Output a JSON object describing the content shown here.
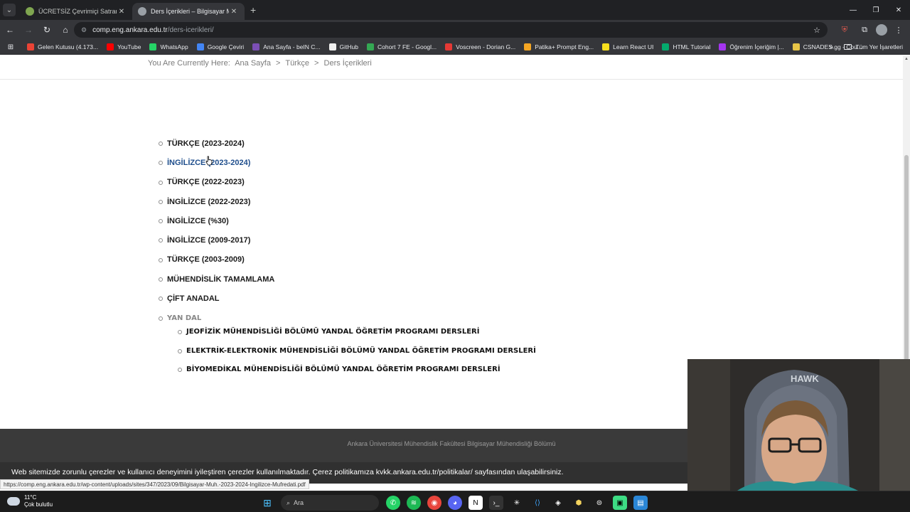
{
  "browser": {
    "tabs": [
      {
        "title": "ÜCRETSİZ Çevrimiçi Satranç Oy",
        "active": false,
        "favicon_color": "#7fa650"
      },
      {
        "title": "Ders İçerikleri – Bilgisayar Mühe",
        "active": true,
        "favicon_color": "#9aa0a6"
      }
    ],
    "url": {
      "host": "comp.eng.ankara.edu.tr",
      "path": "/ders-icerikleri/"
    },
    "bookmarks": [
      {
        "label": "Gelen Kutusu (4.173...",
        "color": "#ea4335"
      },
      {
        "label": "YouTube",
        "color": "#ff0000"
      },
      {
        "label": "WhatsApp",
        "color": "#25d366"
      },
      {
        "label": "Google Çeviri",
        "color": "#4285f4"
      },
      {
        "label": "Ana Sayfa - beIN C...",
        "color": "#7b4fb5"
      },
      {
        "label": "GitHub",
        "color": "#f0f0f0"
      },
      {
        "label": "Cohort 7 FE - Googl...",
        "color": "#34a853"
      },
      {
        "label": "Voscreen - Dorian G...",
        "color": "#e53935"
      },
      {
        "label": "Patika+ Prompt Eng...",
        "color": "#f5a623"
      },
      {
        "label": "Learn React UI",
        "color": "#f7df1e"
      },
      {
        "label": "HTML Tutorial",
        "color": "#04aa6d"
      },
      {
        "label": "Öğrenim İçeriğim |...",
        "color": "#a435f0"
      },
      {
        "label": "CSNADES.gg - Cou...",
        "color": "#e8c547"
      }
    ],
    "all_bookmarks": "Tüm Yer İşaretleri",
    "more_bookmarks": "»"
  },
  "page": {
    "breadcrumb": {
      "prefix": "You Are Currently Here:",
      "items": [
        "Ana Sayfa",
        ">",
        "Türkçe",
        ">",
        "Ders İçerikleri"
      ]
    },
    "links": [
      "TÜRKÇE (2023-2024)",
      "İNGİLİZCE (2023-2024)",
      "TÜRKÇE (2022-2023)",
      "İNGİLİZCE (2022-2023)",
      "İNGİLİZCE (%30)",
      "İNGİLİZCE (2009-2017)",
      "TÜRKÇE (2003-2009)",
      "MÜHENDİSLİK TAMAMLAMA",
      "ÇİFT ANADAL",
      "YAN DAL"
    ],
    "yandal_links": [
      "JEOFİZİK MÜHENDİSLİĞİ BÖLÜMÜ YANDAL ÖĞRETİM PROGRAMI DERSLERİ",
      "ELEKTRİK-ELEKTRONİK MÜHENDİSLİĞİ BÖLÜMÜ YANDAL ÖĞRETİM PROGRAMI DERSLERİ",
      "BİYOMEDİKAL MÜHENDİSLİĞİ BÖLÜMÜ YANDAL ÖĞRETİM PROGRAMI DERSLERİ"
    ],
    "footer": "Ankara Üniversitesi Mühendislik Fakültesi Bilgisayar Mühendisliği Bölümü",
    "cookie_notice": "Web sitemizde zorunlu çerezler ve kullanıcı deneyimini iyileştiren çerezler kullanılmaktadır. Çerez politikamıza kvkk.ankara.edu.tr/politikalar/ sayfasından ulaşabilirsiniz.",
    "status_url": "https://comp.eng.ankara.edu.tr/wp-content/uploads/sites/347/2023/09/Bilgisayar-Muh.-2023-2024-Ingilizce-Mufredati.pdf"
  },
  "taskbar": {
    "temperature": "11°C",
    "weather": "Çok bulutlu",
    "search_placeholder": "Ara"
  },
  "webcam": {
    "chair_brand": "HAWK"
  }
}
